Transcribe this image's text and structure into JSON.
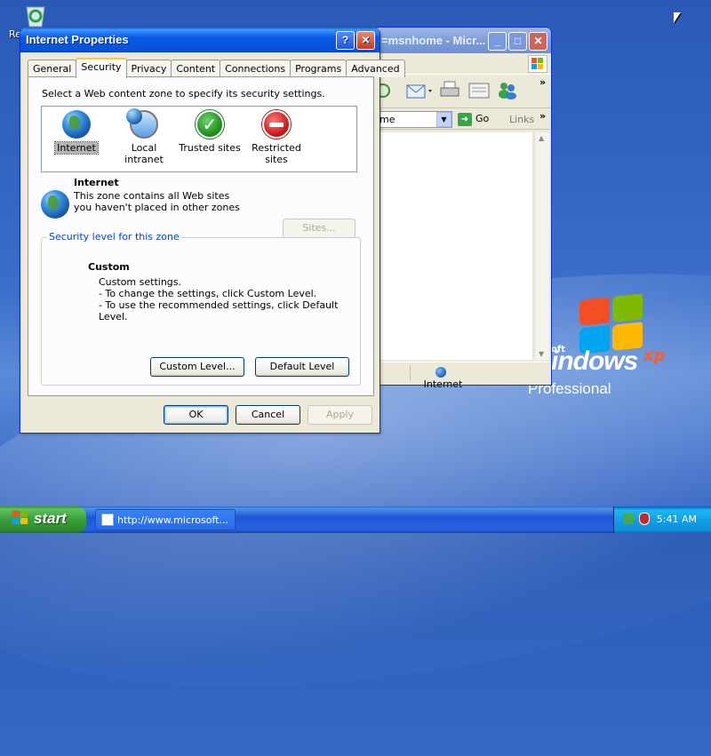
{
  "desktop": {
    "icon_label": "Re",
    "logo": {
      "prefix": "oft",
      "word": "indows",
      "xp": "xp",
      "edition": "Professional"
    }
  },
  "ie_window": {
    "title": "=msnhome - Micr...",
    "address_value": "me",
    "go_label": "Go",
    "links_label": "Links",
    "status_zone": "Internet"
  },
  "dialog": {
    "title": "Internet Properties",
    "help_button": "?",
    "tabs": [
      "General",
      "Security",
      "Privacy",
      "Content",
      "Connections",
      "Programs",
      "Advanced"
    ],
    "active_tab": "Security",
    "prompt": "Select a Web content zone to specify its security settings.",
    "zones": [
      {
        "label": "Internet",
        "icon": "globe-icon"
      },
      {
        "label": "Local intranet",
        "icon": "intranet-icon"
      },
      {
        "label": "Trusted sites",
        "icon": "checkmark-icon"
      },
      {
        "label": "Restricted sites",
        "icon": "no-entry-icon"
      }
    ],
    "zone_info": {
      "title": "Internet",
      "description": "This zone contains all Web sites you haven't placed in other zones",
      "sites_button": "Sites..."
    },
    "security_level": {
      "legend": "Security level for this zone",
      "title": "Custom",
      "lines": [
        "Custom settings.",
        "- To change the settings, click Custom Level.",
        "- To use the recommended settings, click Default Level."
      ],
      "custom_level_button": "Custom Level...",
      "default_level_button": "Default Level"
    },
    "ok_button": "OK",
    "cancel_button": "Cancel",
    "apply_button": "Apply"
  },
  "taskbar": {
    "start_label": "start",
    "task_item": "http://www.microsoft...",
    "clock": "5:41 AM"
  },
  "colors": {
    "title_bar_active": "#0a5ae6",
    "start_green": "#3a9e3a",
    "tab_highlight": "#ffc73c",
    "groupbox_legend": "#0046d5"
  }
}
